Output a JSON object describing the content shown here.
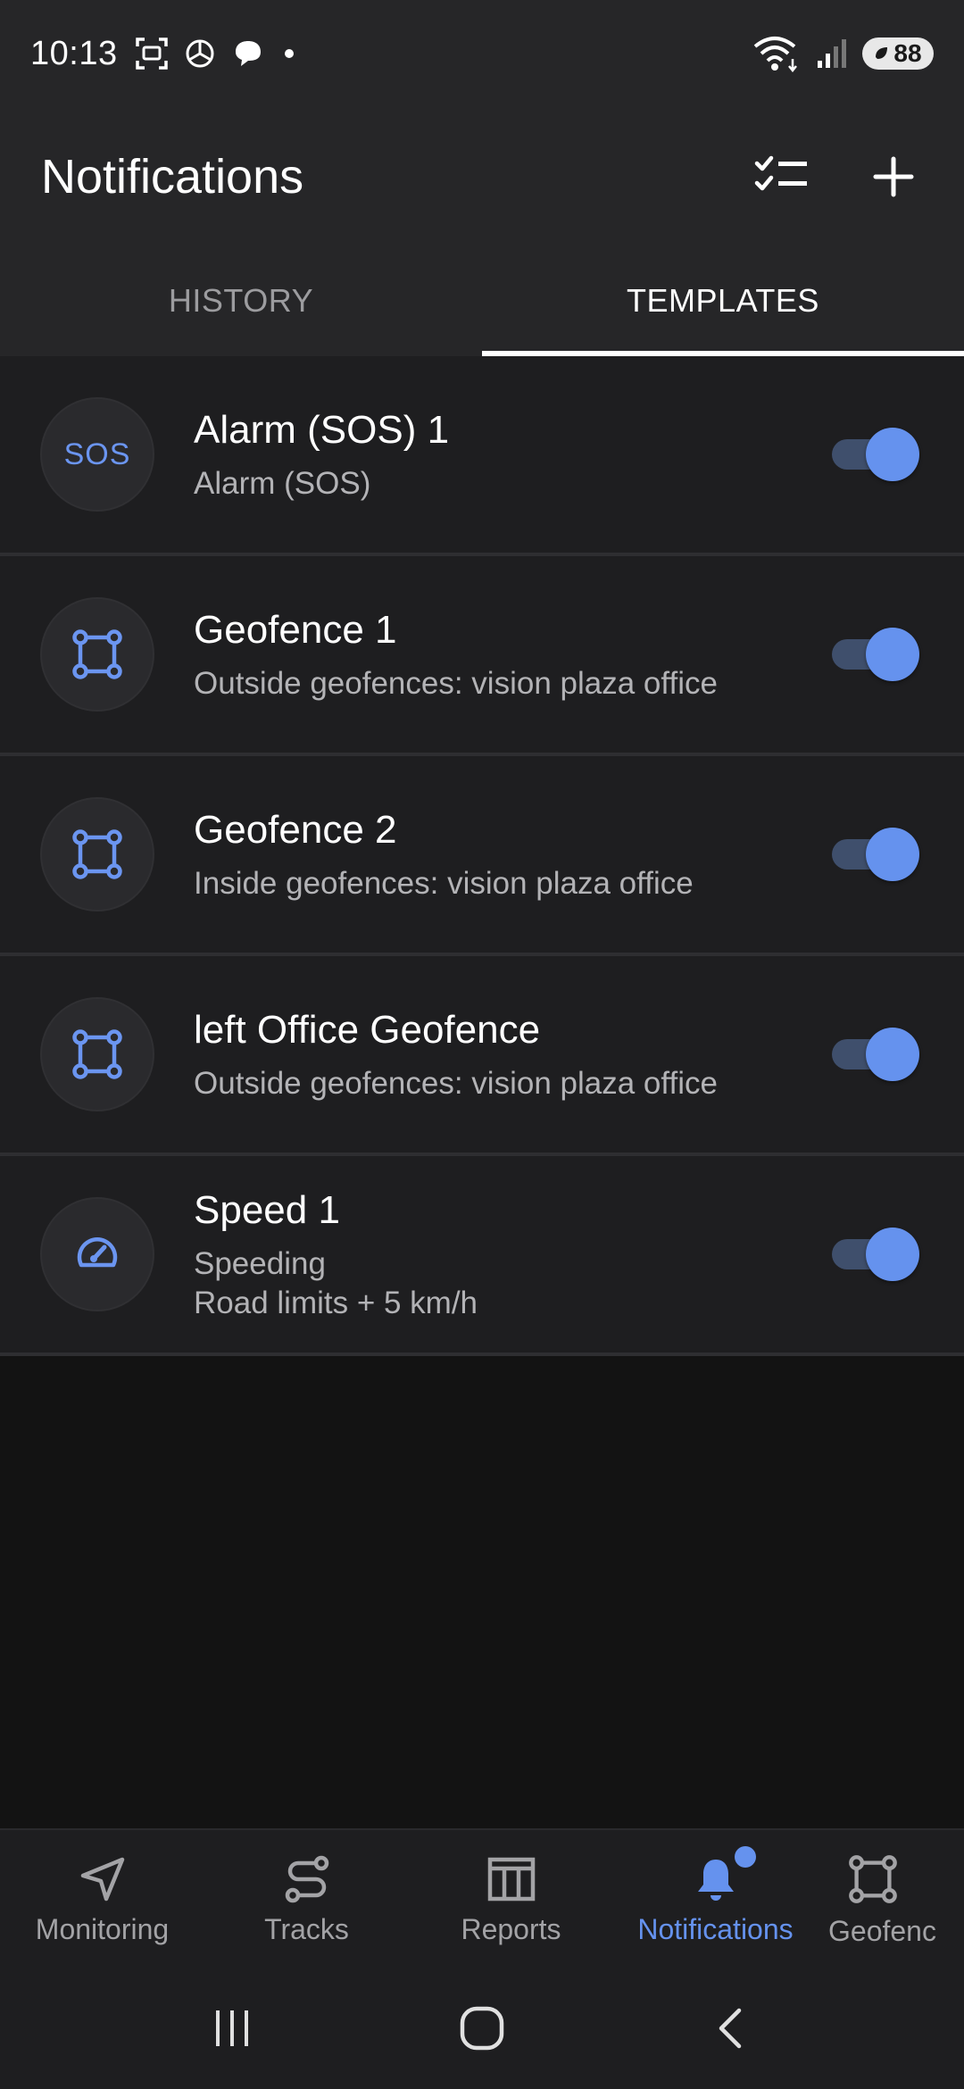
{
  "status": {
    "time": "10:13",
    "battery": "88"
  },
  "app_bar": {
    "title": "Notifications"
  },
  "tabs": [
    {
      "label": "HISTORY",
      "active": false
    },
    {
      "label": "TEMPLATES",
      "active": true
    }
  ],
  "templates": [
    {
      "title": "Alarm (SOS) 1",
      "subtitle": "Alarm (SOS)",
      "subtitle2": "",
      "icon": "sos-icon",
      "icon_text": "SOS",
      "enabled": true
    },
    {
      "title": "Geofence 1",
      "subtitle": "Outside geofences: vision plaza office",
      "subtitle2": "",
      "icon": "geofence-icon",
      "enabled": true
    },
    {
      "title": "Geofence 2",
      "subtitle": "Inside geofences: vision plaza office",
      "subtitle2": "",
      "icon": "geofence-icon",
      "enabled": true
    },
    {
      "title": "left Office Geofence",
      "subtitle": "Outside geofences: vision plaza office",
      "subtitle2": "",
      "icon": "geofence-icon",
      "enabled": true
    },
    {
      "title": "Speed 1",
      "subtitle": "Speeding",
      "subtitle2": "Road limits + 5 km/h",
      "icon": "speedometer-icon",
      "enabled": true
    }
  ],
  "bottom_nav": [
    {
      "label": "Monitoring",
      "icon": "navigation-arrow-icon",
      "active": false
    },
    {
      "label": "Tracks",
      "icon": "route-icon",
      "active": false
    },
    {
      "label": "Reports",
      "icon": "report-table-icon",
      "active": false
    },
    {
      "label": "Notifications",
      "icon": "bell-icon",
      "active": true,
      "badge": true
    },
    {
      "label": "Geofenc",
      "icon": "geofence-icon",
      "active": false
    }
  ],
  "colors": {
    "accent": "#6592ee",
    "surface": "#262628",
    "background": "#131313"
  }
}
